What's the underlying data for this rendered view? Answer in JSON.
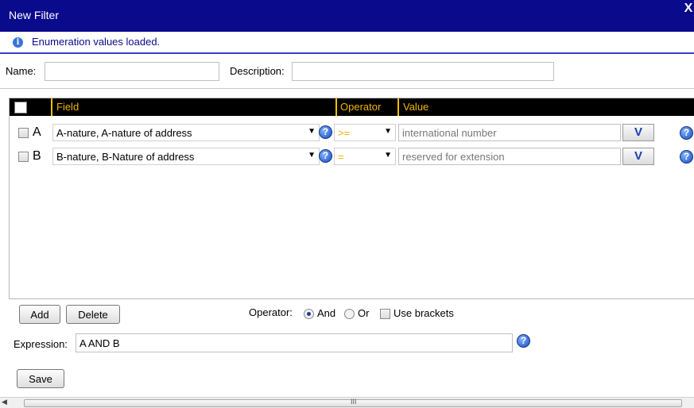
{
  "window": {
    "title": "New Filter",
    "close_glyph": "X"
  },
  "info": {
    "message": "Enumeration values loaded.",
    "icon": "info-icon"
  },
  "name_label": "Name:",
  "name_value": "",
  "description_label": "Description:",
  "description_value": "",
  "grid": {
    "columns": {
      "field": "Field",
      "operator": "Operator",
      "value": "Value"
    },
    "rows": [
      {
        "label": "A",
        "field": "A-nature, A-nature of address",
        "operator": ">=",
        "value": "international number"
      },
      {
        "label": "B",
        "field": "B-nature, B-Nature of address",
        "operator": "=",
        "value": "reserved for extension"
      }
    ]
  },
  "buttons": {
    "add": "Add",
    "delete": "Delete",
    "save": "Save"
  },
  "operator": {
    "label": "Operator:",
    "and": "And",
    "or": "Or",
    "use_brackets": "Use brackets",
    "selected": "And"
  },
  "expression": {
    "label": "Expression:",
    "value": "A AND B"
  },
  "icons": {
    "help": "?",
    "value_dropdown": "V",
    "caret": "▼"
  },
  "scrollbar": {
    "left_arrow": "◀",
    "grip": "III"
  },
  "colors": {
    "titlebar": "#0a0a8c",
    "header_text": "#f4b400"
  }
}
